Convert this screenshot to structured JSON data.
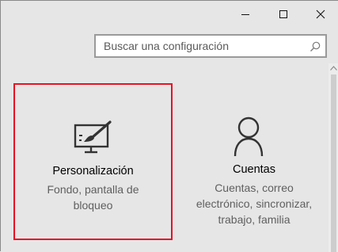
{
  "window": {
    "controls": {
      "minimize_icon": "minimize-icon",
      "maximize_icon": "maximize-icon",
      "close_icon": "close-icon"
    }
  },
  "search": {
    "placeholder": "Buscar una configuración",
    "icon": "search-icon"
  },
  "tiles": [
    {
      "title": "Personalización",
      "description_lines": [
        "Fondo, pantalla de",
        "bloqueo"
      ],
      "icon": "personalization-icon",
      "selected": true
    },
    {
      "title": "Cuentas",
      "description_lines": [
        "Cuentas, correo",
        "electrónico, sincronizar,",
        "trabajo, familia"
      ],
      "icon": "user-icon",
      "selected": false
    }
  ],
  "colors": {
    "background": "#e6e6e6",
    "selection_border": "#e81123",
    "title_text": "#000000",
    "description_text": "#5f5f5f"
  }
}
